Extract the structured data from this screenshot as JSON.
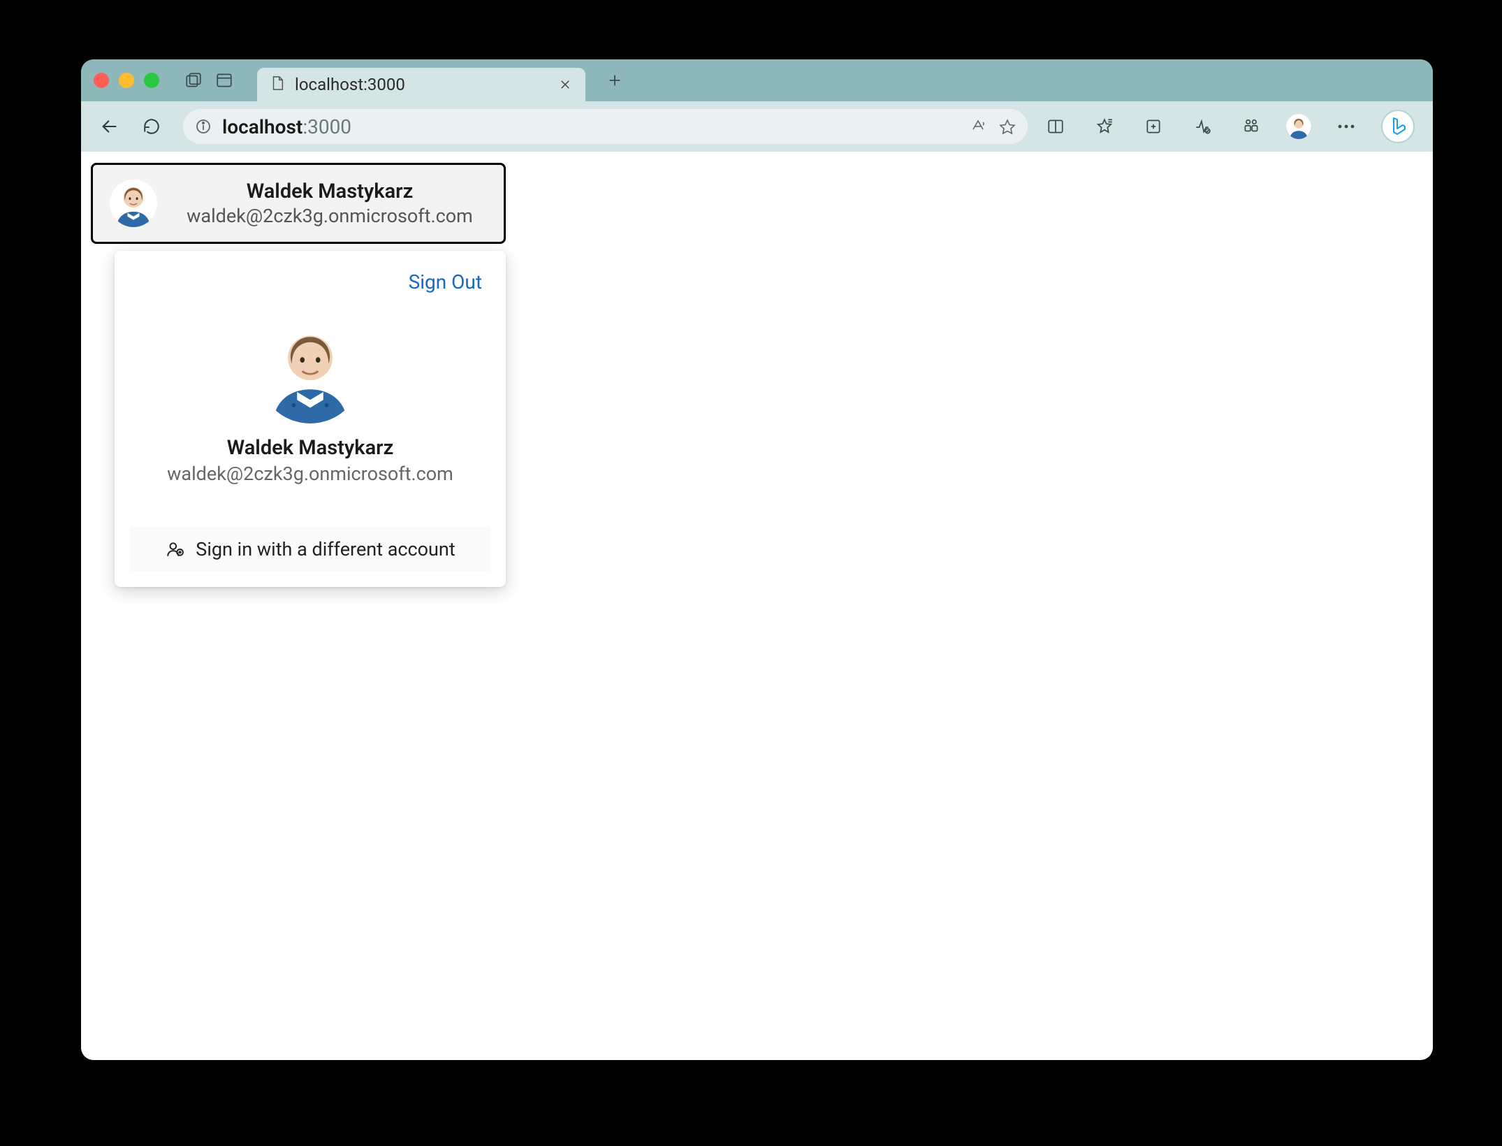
{
  "browser": {
    "tab_title": "localhost:3000",
    "address": {
      "host": "localhost",
      "port": ":3000"
    }
  },
  "login": {
    "name": "Waldek Mastykarz",
    "email": "waldek@2czk3g.onmicrosoft.com"
  },
  "flyout": {
    "sign_out": "Sign Out",
    "name": "Waldek Mastykarz",
    "email": "waldek@2czk3g.onmicrosoft.com",
    "different_account": "Sign in with a different account"
  },
  "icons": {
    "back": "back-icon",
    "refresh": "refresh-icon",
    "info": "info-icon",
    "read_aloud": "read-aloud-icon",
    "star": "star-icon",
    "split": "split-screen-icon",
    "favorites": "favorites-icon",
    "collections": "collections-icon",
    "performance": "performance-icon",
    "app": "app-icon",
    "more": "more-icon",
    "bing": "bing-icon",
    "workspaces": "workspaces-icon",
    "tab_actions": "tab-actions-icon",
    "page": "page-icon",
    "close": "close-icon",
    "plus": "plus-icon",
    "person_switch": "person-switch-icon"
  }
}
